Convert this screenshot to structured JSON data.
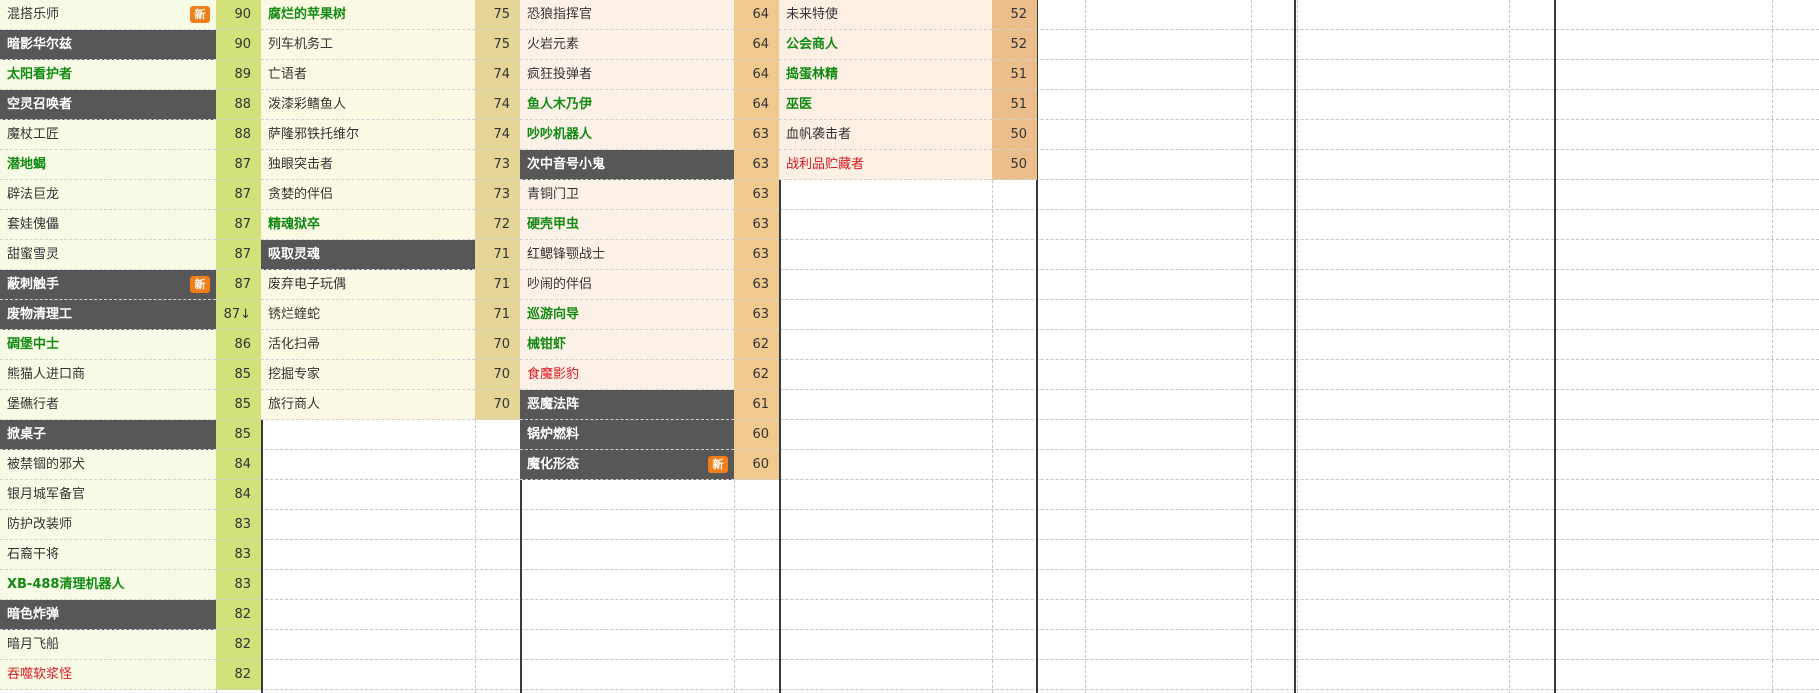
{
  "badge_label": "新",
  "colors": {
    "tier90_name_bg": "#f7fbe6",
    "tier90_score_bg": "#d2e17a",
    "tier70_name_bg": "#fbf8e4",
    "tier70_score_bg": "#e5d597",
    "tier60_name_bg": "#fcf1e7",
    "tier60_score_bg": "#f0c98e",
    "tier50_name_bg": "#fcefe4",
    "tier50_score_bg": "#ebbe8c",
    "dark_row_bg": "#575757",
    "green_text": "#138a13",
    "red_text": "#d9191f",
    "badge_bg": "#f07f1a"
  },
  "columns": [
    {
      "tier": "tier90",
      "rows": [
        {
          "name": "混搭乐师",
          "score": "90",
          "style": "normal",
          "badge": true
        },
        {
          "name": "暗影华尔兹",
          "score": "90",
          "style": "dark"
        },
        {
          "name": "太阳看护者",
          "score": "89",
          "style": "green"
        },
        {
          "name": "空灵召唤者",
          "score": "88",
          "style": "dark"
        },
        {
          "name": "魔杖工匠",
          "score": "88",
          "style": "normal"
        },
        {
          "name": "潜地蝎",
          "score": "87",
          "style": "green"
        },
        {
          "name": "辟法巨龙",
          "score": "87",
          "style": "normal"
        },
        {
          "name": "套娃傀儡",
          "score": "87",
          "style": "normal"
        },
        {
          "name": "甜蜜雪灵",
          "score": "87",
          "style": "normal"
        },
        {
          "name": "蔽刺触手",
          "score": "87",
          "style": "dark",
          "badge": true
        },
        {
          "name": "废物清理工",
          "score": "87↓",
          "style": "dark"
        },
        {
          "name": "碉堡中士",
          "score": "86",
          "style": "green"
        },
        {
          "name": "熊猫人进口商",
          "score": "85",
          "style": "normal"
        },
        {
          "name": "堡礁行者",
          "score": "85",
          "style": "normal"
        },
        {
          "name": "掀桌子",
          "score": "85",
          "style": "dark"
        },
        {
          "name": "被禁锢的邪犬",
          "score": "84",
          "style": "normal"
        },
        {
          "name": "银月城军备官",
          "score": "84",
          "style": "normal"
        },
        {
          "name": "防护改装师",
          "score": "83",
          "style": "normal"
        },
        {
          "name": "石裔干将",
          "score": "83",
          "style": "normal"
        },
        {
          "name": "XB-488清理机器人",
          "score": "83",
          "style": "green"
        },
        {
          "name": "暗色炸弹",
          "score": "82",
          "style": "dark"
        },
        {
          "name": "暗月飞船",
          "score": "82",
          "style": "normal"
        },
        {
          "name": "吞噬软浆怪",
          "score": "82",
          "style": "red"
        }
      ]
    },
    {
      "tier": "tier70",
      "rows": [
        {
          "name": "腐烂的苹果树",
          "score": "75",
          "style": "green"
        },
        {
          "name": "列车机务工",
          "score": "75",
          "style": "normal"
        },
        {
          "name": "亡语者",
          "score": "74",
          "style": "normal"
        },
        {
          "name": "泼漆彩鳍鱼人",
          "score": "74",
          "style": "normal"
        },
        {
          "name": "萨隆邪铁托维尔",
          "score": "74",
          "style": "normal"
        },
        {
          "name": "独眼突击者",
          "score": "73",
          "style": "normal"
        },
        {
          "name": "贪婪的伴侣",
          "score": "73",
          "style": "normal"
        },
        {
          "name": "精魂狱卒",
          "score": "72",
          "style": "green"
        },
        {
          "name": "吸取灵魂",
          "score": "71",
          "style": "dark"
        },
        {
          "name": "废弃电子玩偶",
          "score": "71",
          "style": "normal"
        },
        {
          "name": "锈烂蝰蛇",
          "score": "71",
          "style": "normal"
        },
        {
          "name": "活化扫帚",
          "score": "70",
          "style": "normal"
        },
        {
          "name": "挖掘专家",
          "score": "70",
          "style": "normal"
        },
        {
          "name": "旅行商人",
          "score": "70",
          "style": "normal"
        }
      ]
    },
    {
      "tier": "tier60",
      "rows": [
        {
          "name": "恐狼指挥官",
          "score": "64",
          "style": "normal"
        },
        {
          "name": "火岩元素",
          "score": "64",
          "style": "normal"
        },
        {
          "name": "疯狂投弹者",
          "score": "64",
          "style": "normal"
        },
        {
          "name": "鱼人木乃伊",
          "score": "64",
          "style": "green"
        },
        {
          "name": "吵吵机器人",
          "score": "63",
          "style": "green"
        },
        {
          "name": "次中音号小鬼",
          "score": "63",
          "style": "dark"
        },
        {
          "name": "青铜门卫",
          "score": "63",
          "style": "normal"
        },
        {
          "name": "硬壳甲虫",
          "score": "63",
          "style": "green"
        },
        {
          "name": "红鳃锋颚战士",
          "score": "63",
          "style": "normal"
        },
        {
          "name": "吵闹的伴侣",
          "score": "63",
          "style": "normal"
        },
        {
          "name": "巡游向导",
          "score": "63",
          "style": "green"
        },
        {
          "name": "械钳虾",
          "score": "62",
          "style": "green"
        },
        {
          "name": "食魔影豹",
          "score": "62",
          "style": "red"
        },
        {
          "name": "恶魔法阵",
          "score": "61",
          "style": "dark"
        },
        {
          "name": "锅炉燃料",
          "score": "60",
          "style": "dark"
        },
        {
          "name": "魔化形态",
          "score": "60",
          "style": "dark",
          "badge": true
        }
      ]
    },
    {
      "tier": "tier50",
      "rows": [
        {
          "name": "未来特使",
          "score": "52",
          "style": "normal"
        },
        {
          "name": "公会商人",
          "score": "52",
          "style": "green"
        },
        {
          "name": "捣蛋林精",
          "score": "51",
          "style": "green"
        },
        {
          "name": "巫医",
          "score": "51",
          "style": "green"
        },
        {
          "name": "血帆袭击者",
          "score": "50",
          "style": "normal"
        },
        {
          "name": "战利品贮藏者",
          "score": "50",
          "style": "red"
        }
      ]
    }
  ]
}
